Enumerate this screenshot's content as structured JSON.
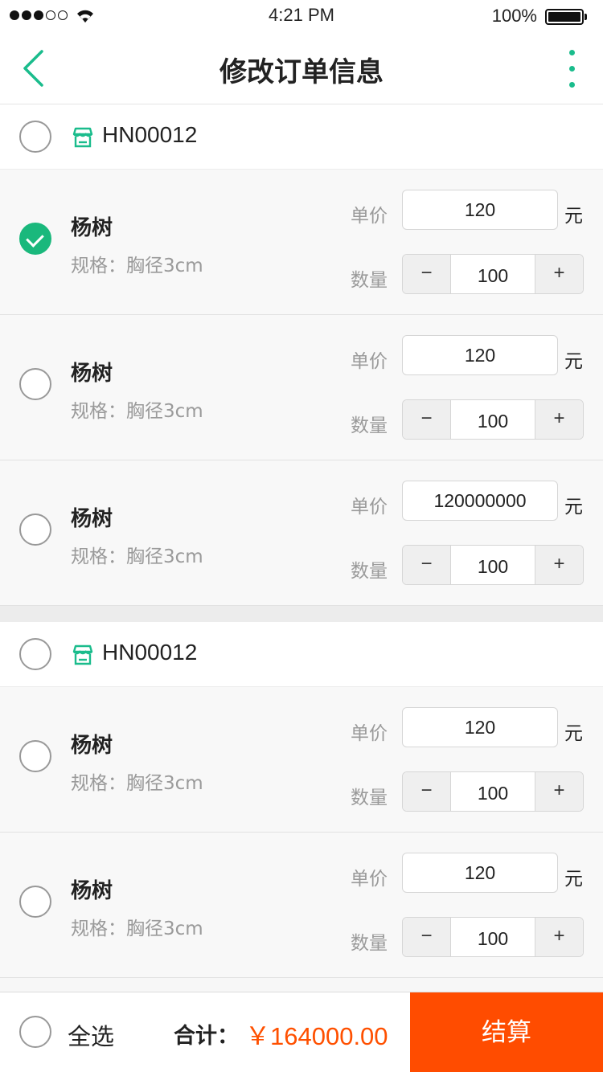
{
  "status_bar": {
    "time": "4:21 PM",
    "battery": "100%"
  },
  "nav": {
    "title": "修改订单信息"
  },
  "labels": {
    "price": "单价",
    "quantity": "数量",
    "unit": "元",
    "minus": "−",
    "plus": "+"
  },
  "groups": [
    {
      "shop_code": "HN00012",
      "checked": false,
      "items": [
        {
          "name": "杨树",
          "spec": "规格：胸径3cm",
          "price": "120",
          "quantity": "100",
          "checked": true
        },
        {
          "name": "杨树",
          "spec": "规格：胸径3cm",
          "price": "120",
          "quantity": "100",
          "checked": false
        },
        {
          "name": "杨树",
          "spec": "规格：胸径3cm",
          "price": "120000000",
          "quantity": "100",
          "checked": false
        }
      ]
    },
    {
      "shop_code": "HN00012",
      "checked": false,
      "items": [
        {
          "name": "杨树",
          "spec": "规格：胸径3cm",
          "price": "120",
          "quantity": "100",
          "checked": false
        },
        {
          "name": "杨树",
          "spec": "规格：胸径3cm",
          "price": "120",
          "quantity": "100",
          "checked": false
        }
      ]
    }
  ],
  "bottom": {
    "select_all": "全选",
    "total_label": "合计：",
    "total_value": "￥164000.00",
    "checkout": "结算"
  },
  "colors": {
    "accent": "#1ab87c",
    "checkout": "#ff4c00",
    "price": "#ff5000"
  }
}
